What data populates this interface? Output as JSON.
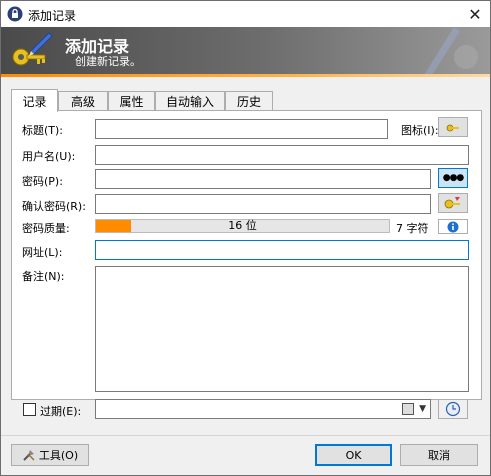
{
  "window": {
    "title": "添加记录",
    "close_glyph": "✕",
    "app_icon": "lock-icon"
  },
  "banner": {
    "title": "添加记录",
    "subtitle": "创建新记录。",
    "accent": "#ff8c00"
  },
  "tabs": [
    {
      "label": "记录",
      "active": true
    },
    {
      "label": "高级"
    },
    {
      "label": "属性"
    },
    {
      "label": "自动输入"
    },
    {
      "label": "历史"
    }
  ],
  "form": {
    "title_label": "标题(T):",
    "title_value": "",
    "icon_label": "图标(I):",
    "username_label": "用户名(U):",
    "username_value": "",
    "password_label": "密码(P):",
    "password_value": "",
    "password_toggle": "●●●",
    "confirm_label": "确认密码(R):",
    "confirm_value": "",
    "quality_label": "密码质量:",
    "quality_bits": "16 位",
    "quality_fraction": 0.12,
    "quality_chars": "7 字符",
    "url_label": "网址(L):",
    "url_value": "",
    "notes_label": "备注(N):",
    "notes_value": "",
    "expires_label": "过期(E):",
    "expires_value": ""
  },
  "footer": {
    "tools_label": "工具(O)",
    "ok_label": "OK",
    "cancel_label": "取消"
  }
}
